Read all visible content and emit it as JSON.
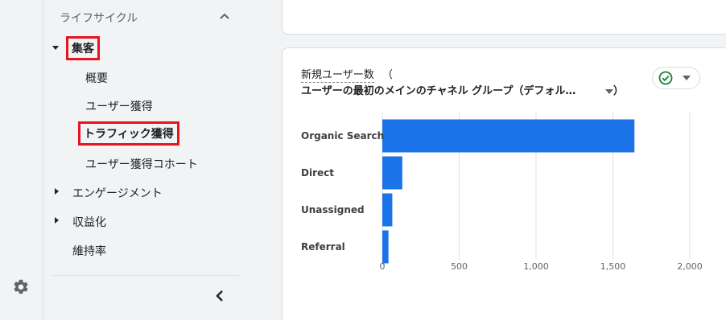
{
  "nav": {
    "section_title": "ライフサイクル",
    "items": [
      {
        "label": "集客",
        "level": 0,
        "expanded": true,
        "highlighted": true
      },
      {
        "label": "概要",
        "level": 1
      },
      {
        "label": "ユーザー獲得",
        "level": 1
      },
      {
        "label": "トラフィック獲得",
        "level": 1,
        "highlighted": true
      },
      {
        "label": "ユーザー獲得コホート",
        "level": 1
      },
      {
        "label": "エンゲージメント",
        "level": 0,
        "expanded": false
      },
      {
        "label": "収益化",
        "level": 0,
        "expanded": false
      },
      {
        "label": "維持率",
        "level": 0
      }
    ]
  },
  "icons": {
    "settings": "gear-icon",
    "collapse_section": "chevron-up-icon",
    "collapse_nav": "chevron-left-icon",
    "status": "check-circle-icon"
  },
  "card": {
    "title_line1": "新規ユーザー数",
    "title_paren_open": "（",
    "title_line2": "ユーザーの最初のメインのチャネル グループ（デフォル…",
    "title_paren_close": "）"
  },
  "colors": {
    "bar": "#1a73e8",
    "highlight_border": "#e8131f",
    "status_check": "#188038"
  },
  "chart_data": {
    "type": "bar",
    "orientation": "horizontal",
    "categories": [
      "Organic Search",
      "Direct",
      "Unassigned",
      "Referral"
    ],
    "values": [
      1640,
      130,
      65,
      40
    ],
    "xlim": [
      0,
      2000
    ],
    "xticks": [
      "0",
      "500",
      "1,000",
      "1,500",
      "2,000"
    ],
    "xtick_values": [
      0,
      500,
      1000,
      1500,
      2000
    ],
    "grid": true
  }
}
